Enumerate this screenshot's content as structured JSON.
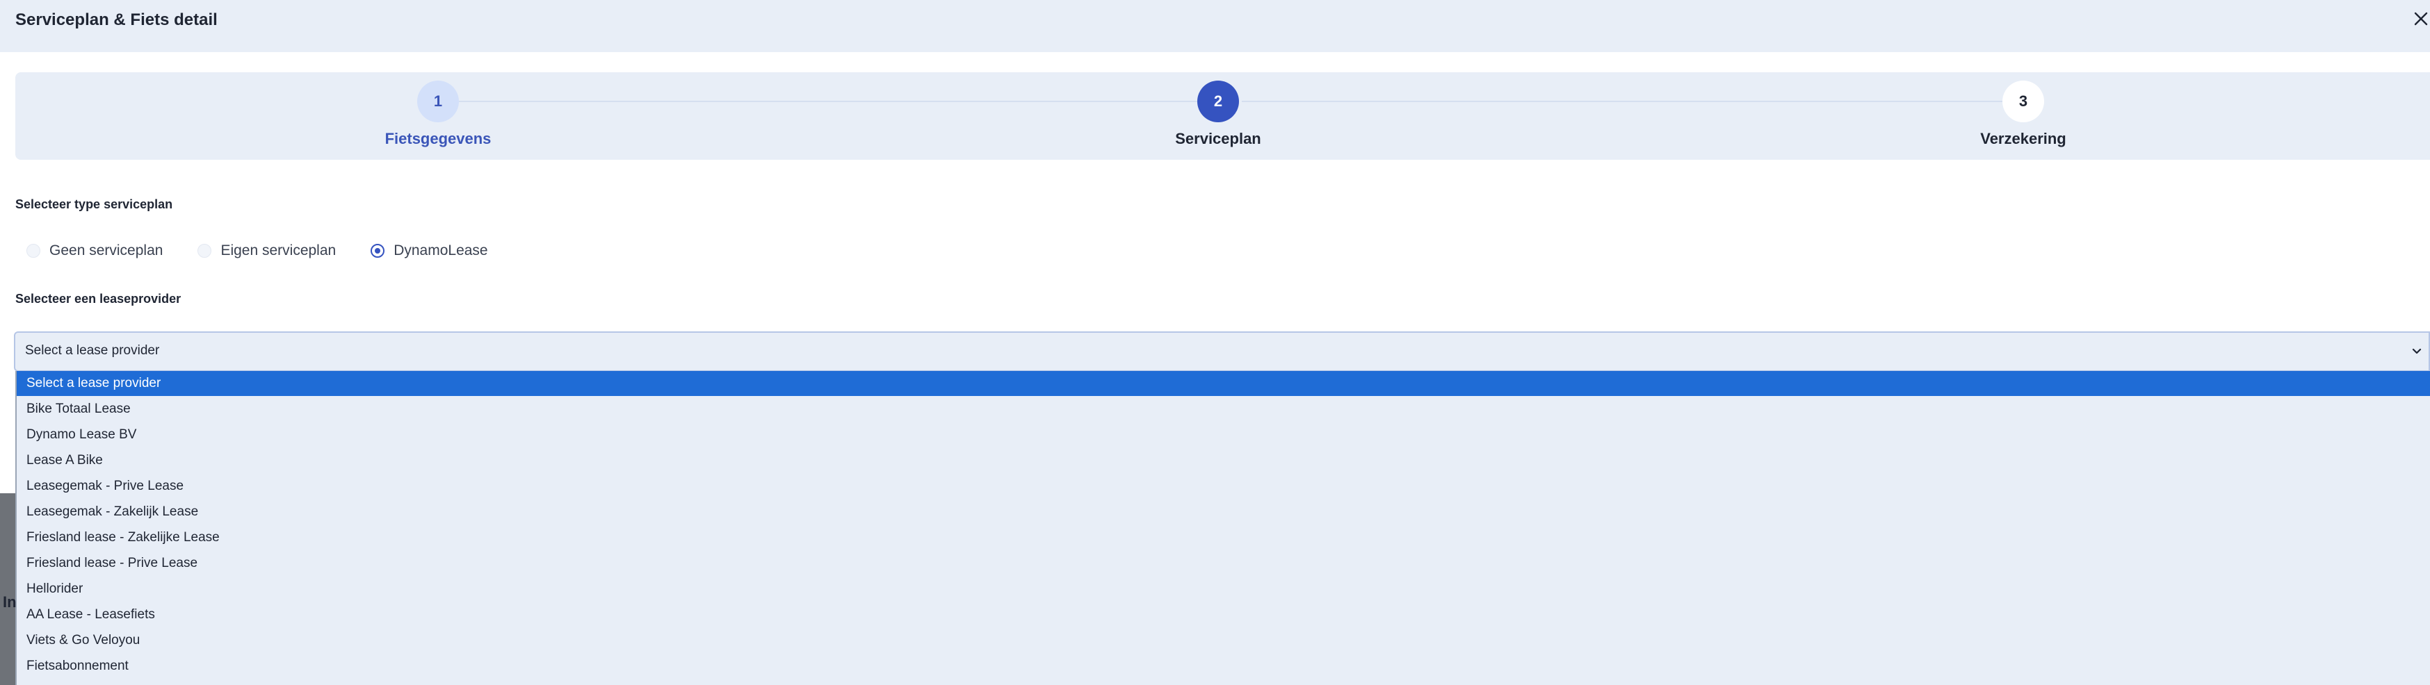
{
  "modal": {
    "title": "Serviceplan & Fiets detail"
  },
  "stepper": {
    "steps": [
      {
        "number": "1",
        "label": "Fietsgegevens",
        "state": "completed"
      },
      {
        "number": "2",
        "label": "Serviceplan",
        "state": "active"
      },
      {
        "number": "3",
        "label": "Verzekering",
        "state": "upcoming"
      }
    ]
  },
  "serviceplan": {
    "label": "Selecteer type serviceplan",
    "options": [
      {
        "label": "Geen serviceplan",
        "checked": false
      },
      {
        "label": "Eigen serviceplan",
        "checked": false
      },
      {
        "label": "DynamoLease",
        "checked": true
      }
    ]
  },
  "leaseprovider": {
    "label": "Selecteer een leaseprovider",
    "selected_value": "Select a lease provider",
    "options": [
      "Select a lease provider",
      "Bike Totaal Lease",
      "Dynamo Lease BV",
      "Lease A Bike",
      "Leasegemak - Prive Lease",
      "Leasegemak - Zakelijk Lease",
      "Friesland lease - Zakelijke Lease",
      "Friesland lease - Prive Lease",
      "Hellorider",
      "AA Lease - Leasefiets",
      "Viets & Go Veloyou",
      "Fietsabonnement"
    ]
  },
  "backdrop": {
    "fragment": "In"
  },
  "colors": {
    "accent": "#3553c0",
    "highlight": "#1f6cd6",
    "panel": "#e8eef7"
  }
}
